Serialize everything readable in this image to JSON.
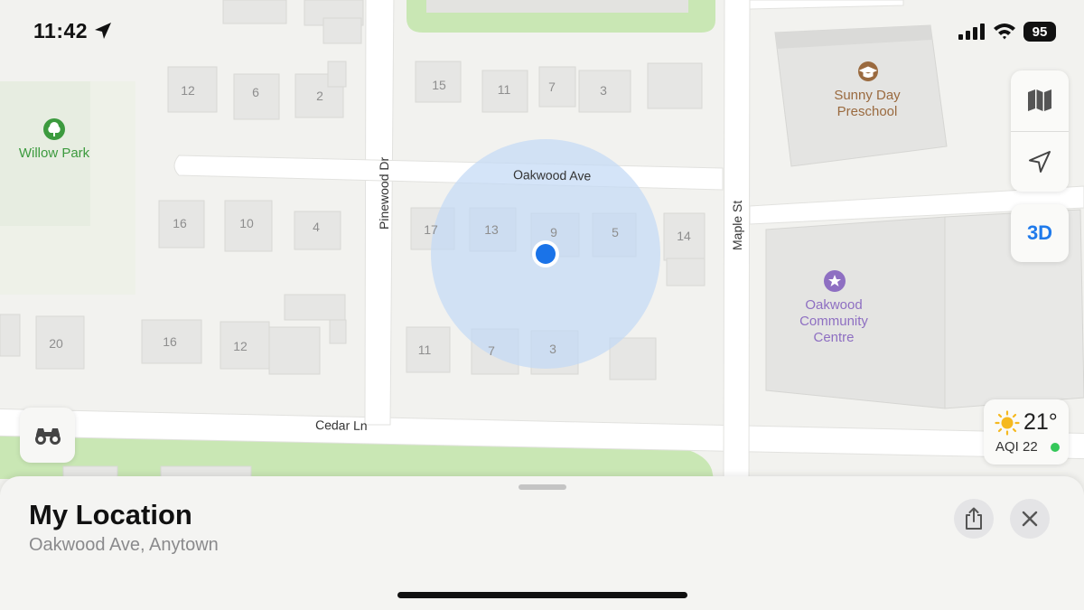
{
  "status_bar": {
    "time": "11:42",
    "battery": "95",
    "icons": [
      "location-arrow-icon",
      "cellular-signal-icon",
      "wifi-icon",
      "battery-icon"
    ]
  },
  "map": {
    "streets": {
      "oakwood": "Oakwood Ave",
      "pinewood": "Pinewood Dr",
      "maple": "Maple St",
      "cedar": "Cedar Ln"
    },
    "pois": {
      "park": "Willow Park",
      "preschool_line1": "Sunny Day",
      "preschool_line2": "Preschool",
      "centre_line1": "Oakwood",
      "centre_line2": "Community",
      "centre_line3": "Centre"
    },
    "house_numbers": [
      "12",
      "6",
      "2",
      "15",
      "11",
      "7",
      "3",
      "16",
      "10",
      "4",
      "17",
      "13",
      "9",
      "5",
      "14",
      "20",
      "16",
      "12",
      "11",
      "7",
      "3"
    ],
    "colors": {
      "land": "#f2f2ef",
      "road": "#ffffff",
      "building": "#e6e6e4",
      "park": "#c9e7b4",
      "park_label": "#3c9a3e",
      "poi_preschool": "#9a6a3f",
      "poi_community": "#8e6fc2",
      "accuracy_circle": "#c4d9f5",
      "location_dot": "#1a73e8"
    }
  },
  "controls": {
    "map_mode_icon": "map-icon",
    "track_icon": "location-arrow-outline-icon",
    "three_d": "3D",
    "look_around_icon": "binoculars-icon"
  },
  "weather": {
    "temperature": "21°",
    "aqi": "AQI 22",
    "icon": "sun-icon",
    "aqi_color": "#34c759"
  },
  "sheet": {
    "title": "My Location",
    "subtitle": "Oakwood Ave, Anytown",
    "share_icon": "share-icon",
    "close_icon": "close-icon"
  }
}
